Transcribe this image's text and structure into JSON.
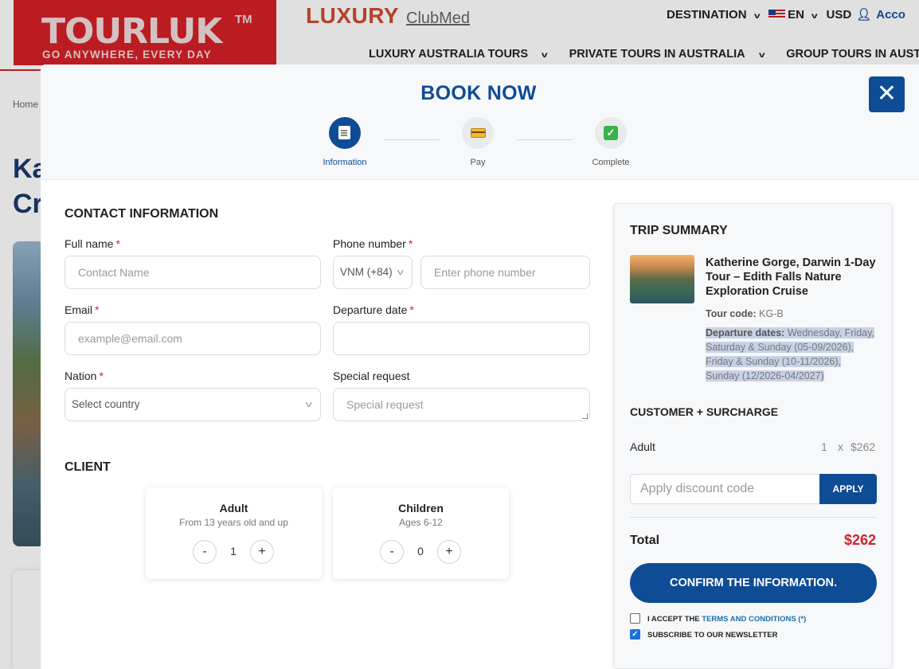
{
  "site": {
    "logo_name": "TOURLUK",
    "logo_tm": "TM",
    "logo_tagline": "GO ANYWHERE, EVERY DAY",
    "luxury": "LUXURY",
    "clubmed": "ClubMed",
    "topnav": {
      "destination": "DESTINATION",
      "language": "EN",
      "currency": "USD",
      "account": "Acco"
    },
    "mainnav": [
      "LUXURY AUSTRALIA TOURS",
      "PRIVATE TOURS IN AUSTRALIA",
      "GROUP TOURS IN AUSTRALIA"
    ],
    "breadcrumb": "Home",
    "bg_title_line1": "Ka",
    "bg_title_line2": "Cr",
    "brand_color": "#d52027"
  },
  "modal": {
    "title": "BOOK NOW",
    "close_label": "✕",
    "accent_color": "#0f4c96",
    "steps": [
      {
        "label": "Information",
        "icon": "clipboard-icon",
        "active": true
      },
      {
        "label": "Pay",
        "icon": "credit-card-icon",
        "active": false
      },
      {
        "label": "Complete",
        "icon": "check-box-icon",
        "active": false
      }
    ]
  },
  "contact": {
    "section_title": "CONTACT INFORMATION",
    "full_name": {
      "label": "Full name",
      "placeholder": "Contact Name"
    },
    "phone": {
      "label": "Phone number",
      "country_code": "VNM (+84)",
      "placeholder": "Enter phone number"
    },
    "email": {
      "label": "Email",
      "placeholder": "example@email.com"
    },
    "departure": {
      "label": "Departure date",
      "value": ""
    },
    "nation": {
      "label": "Nation",
      "value": "Select country"
    },
    "special": {
      "label": "Special request",
      "placeholder": "Special request"
    },
    "required_mark": "*"
  },
  "client": {
    "section_title": "CLIENT",
    "adult": {
      "title": "Adult",
      "subtitle": "From 13 years old and up",
      "qty": "1"
    },
    "children": {
      "title": "Children",
      "subtitle": "Ages 6-12",
      "qty": "0"
    },
    "minus": "-",
    "plus": "+"
  },
  "summary": {
    "title": "TRIP SUMMARY",
    "tour_name": "Katherine Gorge, Darwin 1-Day Tour – Edith Falls Nature Exploration Cruise",
    "tour_code_label": "Tour code:",
    "tour_code": "KG-B",
    "departure_label": "Departure dates:",
    "departure_text": "Wednesday, Friday, Saturday & Sunday (05-09/2026), Friday & Sunday (10-11/2026), Sunday (12/2026-04/2027)",
    "surcharge_title": "CUSTOMER + SURCHARGE",
    "adult_label": "Adult",
    "adult_qty": "1",
    "times": "x",
    "adult_price": "$262",
    "discount_placeholder": "Apply discount code",
    "apply_label": "APPLY",
    "total_label": "Total",
    "total_value": "$262",
    "confirm_label": "CONFIRM THE INFORMATION.",
    "terms_prefix": "I ACCEPT THE",
    "terms_link": "TERMS AND CONDITIONS (*)",
    "terms_checked": false,
    "newsletter_label": "SUBSCRIBE TO OUR NEWSLETTER",
    "newsletter_checked": true,
    "price_color": "#d52027"
  }
}
